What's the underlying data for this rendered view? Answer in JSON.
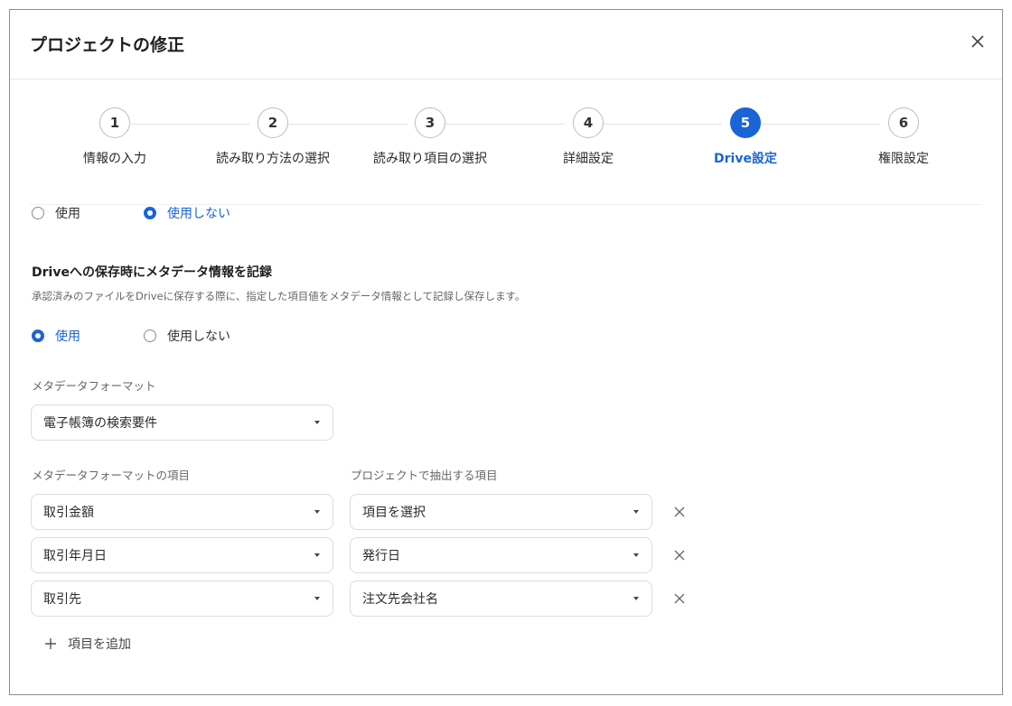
{
  "dialog": {
    "title": "プロジェクトの修正"
  },
  "steps": [
    {
      "number": "1",
      "label": "情報の入力"
    },
    {
      "number": "2",
      "label": "読み取り方法の選択"
    },
    {
      "number": "3",
      "label": "読み取り項目の選択"
    },
    {
      "number": "4",
      "label": "詳細設定"
    },
    {
      "number": "5",
      "label": "Drive設定"
    },
    {
      "number": "6",
      "label": "権限設定"
    }
  ],
  "active_step": 5,
  "top_radio": {
    "use_label": "使用",
    "not_use_label": "使用しない",
    "selected": "not_use"
  },
  "metadata_section": {
    "title": "Driveへの保存時にメタデータ情報を記録",
    "description": "承認済みのファイルをDriveに保存する際に、指定した項目値をメタデータ情報として記録し保存します。",
    "use_label": "使用",
    "not_use_label": "使用しない",
    "selected": "use",
    "format_label": "メタデータフォーマット",
    "format_value": "電子帳簿の検索要件",
    "items_label": "メタデータフォーマットの項目",
    "project_items_label": "プロジェクトで抽出する項目",
    "rows": [
      {
        "metadata_item": "取引金額",
        "project_item": "項目を選択"
      },
      {
        "metadata_item": "取引年月日",
        "project_item": "発行日"
      },
      {
        "metadata_item": "取引先",
        "project_item": "注文先会社名"
      }
    ],
    "add_item_label": "項目を追加"
  },
  "colors": {
    "accent": "#1a64d6",
    "border": "#dcdcdc"
  }
}
